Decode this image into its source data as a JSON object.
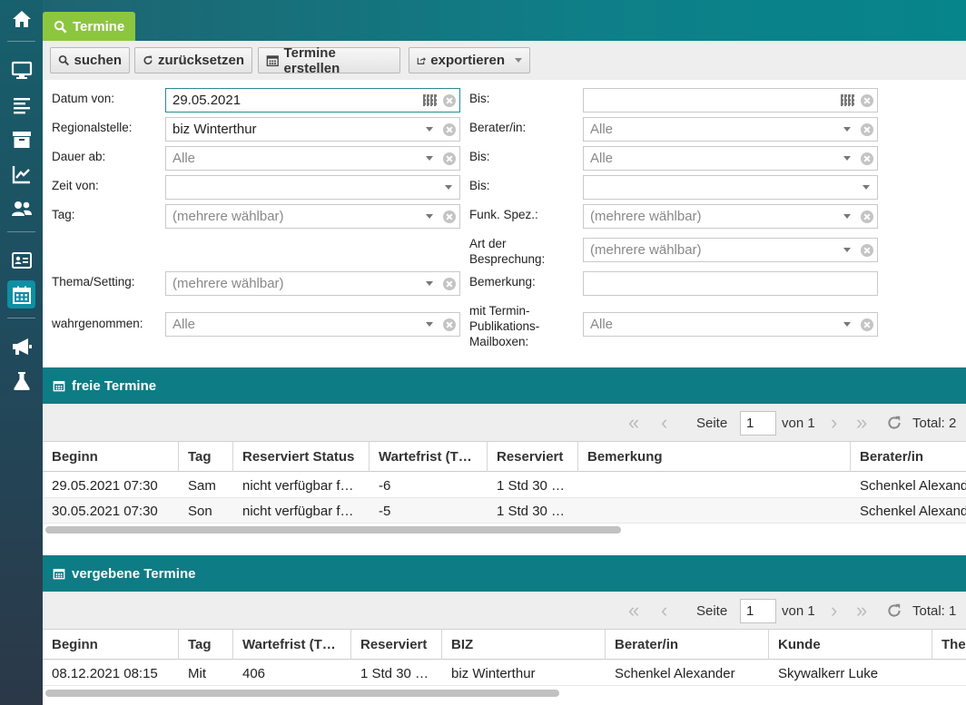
{
  "sidebar": {
    "items": [
      "home-icon",
      "monitor-icon",
      "list-icon",
      "archive-icon",
      "chart-line-icon",
      "users-icon",
      "id-card-icon",
      "calendar-icon",
      "megaphone-icon",
      "flask-icon"
    ]
  },
  "tab": {
    "label": "Termine"
  },
  "toolbar": {
    "search": "suchen",
    "reset": "zurücksetzen",
    "create": "Termine erstellen",
    "export": "exportieren"
  },
  "form": {
    "datum_von": {
      "label": "Datum von:",
      "value": "29.05.2021"
    },
    "datum_bis": {
      "label": "Bis:",
      "value": ""
    },
    "regionalstelle": {
      "label": "Regionalstelle:",
      "value": "biz Winterthur"
    },
    "berater": {
      "label": "Berater/in:",
      "value": "Alle"
    },
    "dauer_ab": {
      "label": "Dauer ab:",
      "value": "Alle"
    },
    "dauer_bis": {
      "label": "Bis:",
      "value": "Alle"
    },
    "zeit_von": {
      "label": "Zeit von:",
      "value": ""
    },
    "zeit_bis": {
      "label": "Bis:",
      "value": ""
    },
    "tag": {
      "label": "Tag:",
      "value": "(mehrere wählbar)"
    },
    "funk_spez": {
      "label": "Funk. Spez.:",
      "value": "(mehrere wählbar)"
    },
    "art_besprechung": {
      "label": "Art der Besprechung:",
      "value": "(mehrere wählbar)"
    },
    "thema": {
      "label": "Thema/Setting:",
      "value": "(mehrere wählbar)"
    },
    "bemerkung": {
      "label": "Bemerkung:",
      "value": ""
    },
    "wahrgenommen": {
      "label": "wahrgenommen:",
      "value": "Alle"
    },
    "mailboxen": {
      "label": "mit Termin-Publikations-Mailboxen:",
      "value": "Alle"
    }
  },
  "free": {
    "title": "freie Termine",
    "pager": {
      "first": "«",
      "prev": "‹",
      "page_label": "Seite",
      "page": "1",
      "of": "von 1",
      "next": "›",
      "last": "»",
      "total": "Total: 2"
    },
    "columns": [
      "Beginn",
      "Tag",
      "Reserviert Status",
      "Wartefrist (T…",
      "Reserviert",
      "Bemerkung",
      "Berater/in"
    ],
    "rows": [
      [
        "29.05.2021   07:30",
        "Sam",
        "nicht verfügbar f…",
        "-6",
        "1 Std 30 …",
        "",
        "Schenkel Alexander"
      ],
      [
        "30.05.2021   07:30",
        "Son",
        "nicht verfügbar f…",
        "-5",
        "1 Std 30 …",
        "",
        "Schenkel Alexander"
      ]
    ]
  },
  "assigned": {
    "title": "vergebene Termine",
    "pager": {
      "first": "«",
      "prev": "‹",
      "page_label": "Seite",
      "page": "1",
      "of": "von 1",
      "next": "›",
      "last": "»",
      "total": "Total: 1"
    },
    "columns": [
      "Beginn",
      "Tag",
      "Wartefrist (T…",
      "Reserviert",
      "BIZ",
      "Berater/in",
      "Kunde",
      "Thema"
    ],
    "rows": [
      [
        "08.12.2021   08:15",
        "Mit",
        "406",
        "1 Std 30 …",
        "biz Winterthur",
        "Schenkel Alexander",
        "Skywalkerr Luke",
        ""
      ]
    ]
  },
  "colors": {
    "accent_green": "#8cc63f",
    "teal": "#0e7c85",
    "sidebar_active": "#0e8fa3"
  }
}
